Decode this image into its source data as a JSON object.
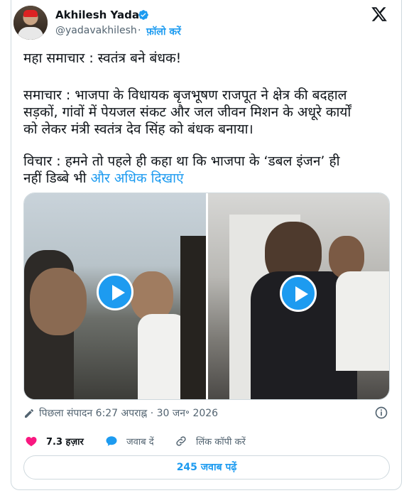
{
  "author": {
    "name": "Akhilesh Yadav",
    "handle": "@yadavakhilesh",
    "separator": "·",
    "follow_label": "फ़ॉलो करें"
  },
  "icons": {
    "verified": "verified-badge-icon",
    "logo": "x-logo-icon",
    "play": "play-icon",
    "edit": "pencil-icon",
    "info": "info-icon",
    "like": "heart-icon",
    "reply": "reply-icon",
    "link": "link-icon"
  },
  "post": {
    "line1": "महा समाचार : स्वतंत्र बने बंधक!",
    "line2": "समाचार : भाजपा के विधायक बृजभूषण राजपूत ने क्षेत्र की बदहाल",
    "line3": "सड़कों, गांवों में पेयजल संकट और जल जीवन मिशन के अधूरे  कार्यों",
    "line4": "को लेकर मंत्री स्वतंत्र देव सिंह को बंधक बनाया।",
    "line5": "विचार : हमने तो पहले ही कहा था कि भाजपा के ‘डबल इंजन’ ही",
    "line6": "नहीं डिब्बे भी",
    "show_more": "और अधिक दिखाएं"
  },
  "meta": {
    "edited": "पिछला संपादन 6:27 अपराह्न · 30 जन॰ 2026"
  },
  "actions": {
    "likes": "7.3 हज़ार",
    "reply_label": "जवाब दें",
    "copy_link_label": "लिंक कॉपी करें"
  },
  "replies_button": "245 जवाब पढ़ें",
  "colors": {
    "accent": "#1d9bf0",
    "like": "#f91880",
    "text": "#0f1419",
    "muted": "#536471",
    "border": "#cfd9de"
  }
}
